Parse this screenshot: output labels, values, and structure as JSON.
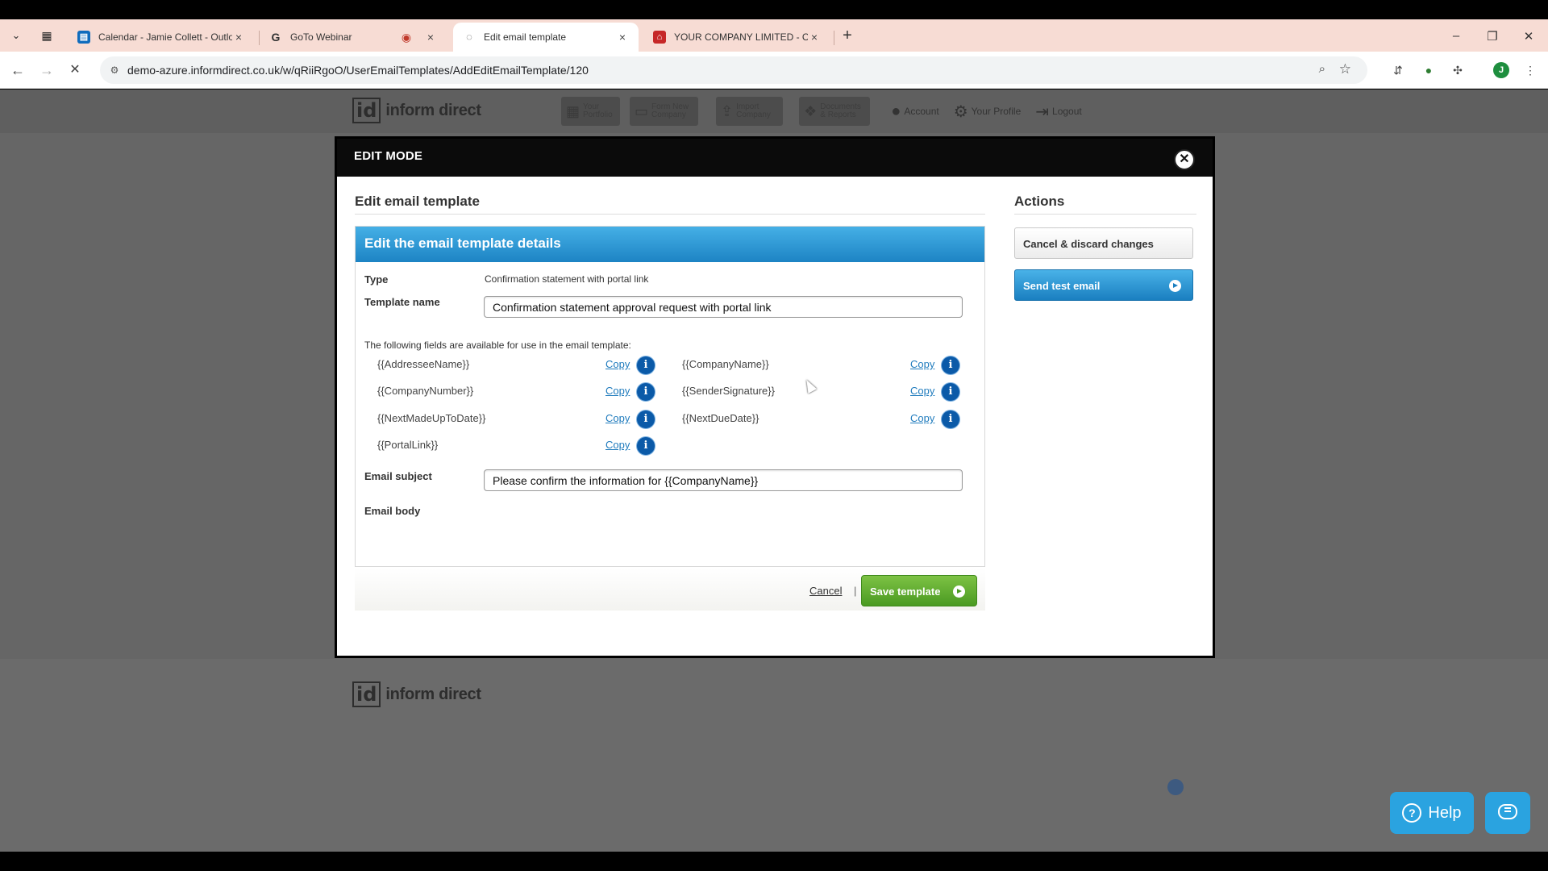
{
  "browser": {
    "tabs": [
      {
        "title": "Calendar - Jamie Collett - Outlo",
        "favicon": "outlook-calendar-icon"
      },
      {
        "title": "GoTo Webinar",
        "favicon": "goto-icon"
      },
      {
        "title": "Edit email template",
        "favicon": "loading-icon"
      },
      {
        "title": "YOUR COMPANY LIMITED - Co",
        "favicon": "pdf-icon"
      }
    ],
    "active_tab_index": 2,
    "url": "demo-azure.informdirect.co.uk/w/qRiiRgoO/UserEmailTemplates/AddEditEmailTemplate/120",
    "profile_initial": "J"
  },
  "site": {
    "logo_mark": "id",
    "logo_text": "inform direct",
    "nav": {
      "portfolio": "Your Portfolio",
      "form_company": "Form New Company",
      "import_company": "Import Company",
      "documents": "Documents & Reports",
      "account": "Account",
      "profile": "Your Profile",
      "logout": "Logout"
    }
  },
  "modal": {
    "header": "EDIT MODE",
    "title": "Edit email template",
    "panel_title": "Edit the email template details",
    "type_label": "Type",
    "type_value": "Confirmation statement with portal link",
    "name_label": "Template name",
    "name_value": "Confirmation statement approval request with portal link",
    "fields_intro": "The following fields are available for use in the email template:",
    "copy_label": "Copy",
    "placeholders": [
      "{{AddresseeName}}",
      "{{CompanyName}}",
      "{{CompanyNumber}}",
      "{{SenderSignature}}",
      "{{NextMadeUpToDate}}",
      "{{NextDueDate}}",
      "{{PortalLink}}"
    ],
    "subject_label": "Email subject",
    "subject_value": "Please confirm the information for {{CompanyName}}",
    "body_label": "Email body",
    "cancel_link": "Cancel",
    "separator": "|",
    "save_button": "Save template",
    "actions_title": "Actions",
    "cancel_discard": "Cancel & discard changes",
    "send_test": "Send test email"
  },
  "widgets": {
    "help": "Help"
  },
  "colors": {
    "panel_header": "#1d84c4",
    "save_green": "#4a9a22",
    "info_blue": "#0b5aa8",
    "help_blue": "#2aa3e0"
  }
}
